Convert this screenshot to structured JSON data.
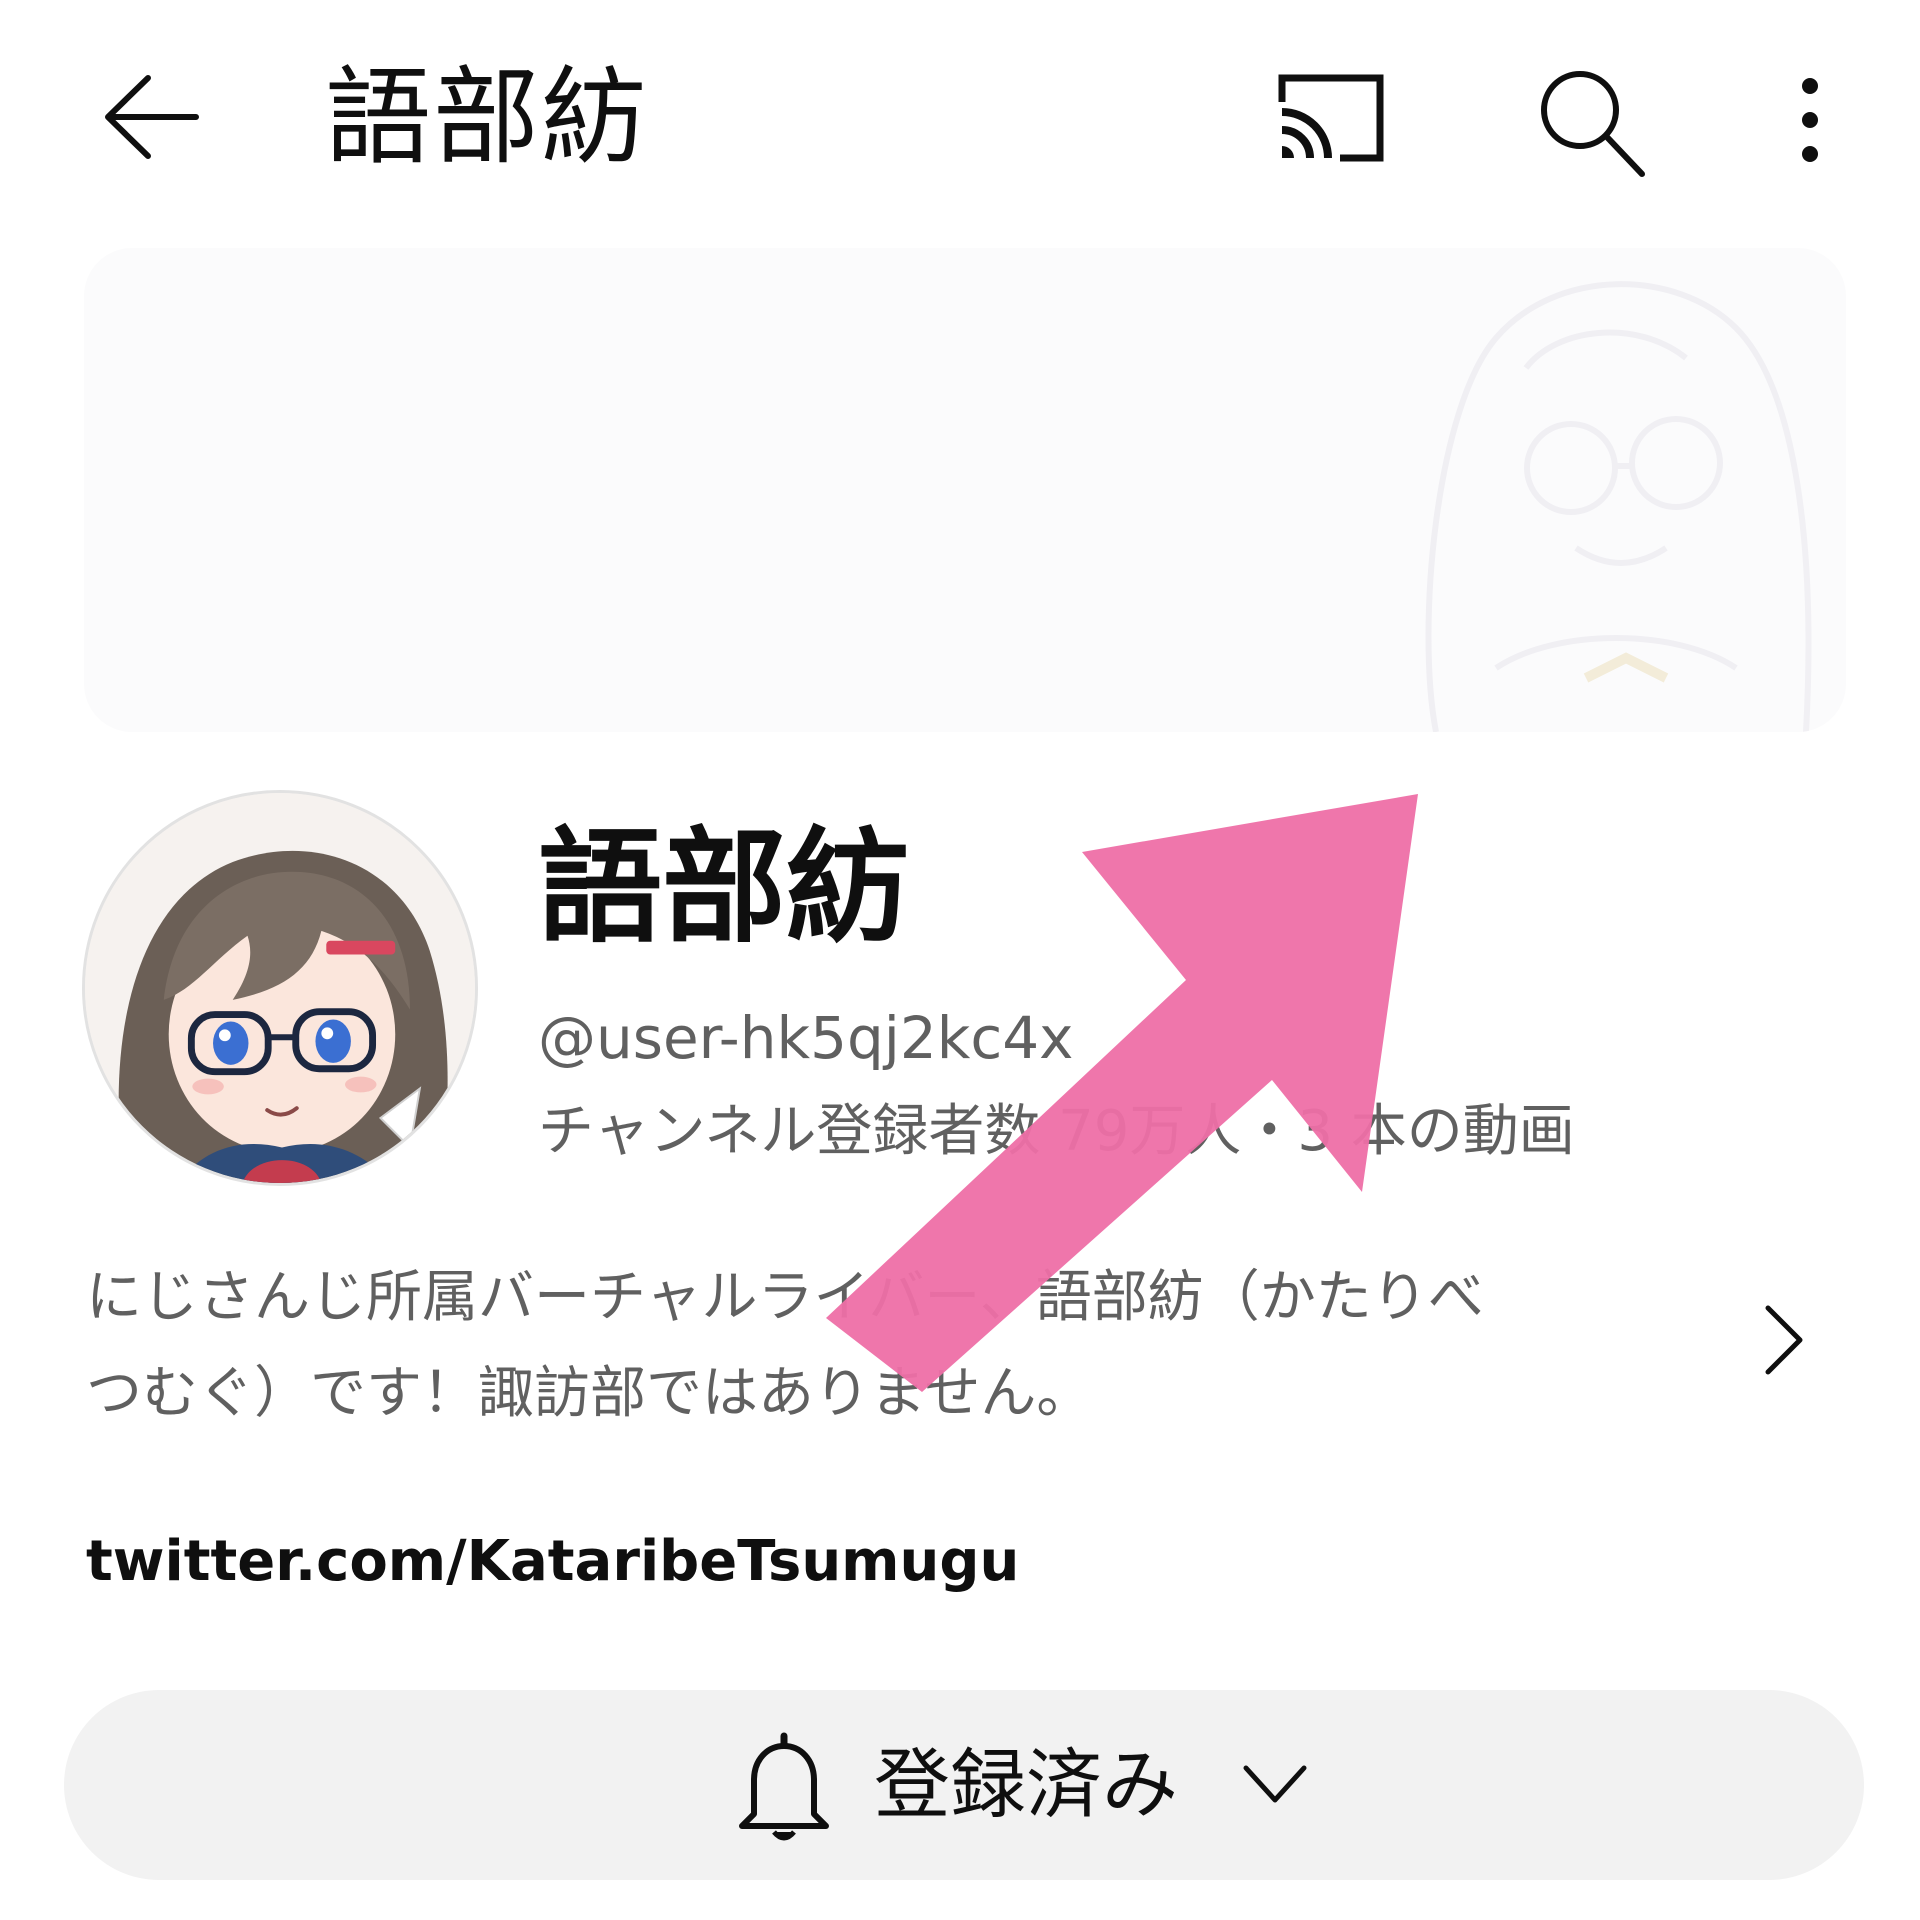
{
  "appbar": {
    "title": "語部紡",
    "icons": [
      "back-arrow-icon",
      "cast-icon",
      "search-icon",
      "more-vert-icon"
    ]
  },
  "channel": {
    "name": "語部紡",
    "handle": "@user-hk5qj2kc4x",
    "stats": "チャンネル登録者数 79万人・3 本の動画",
    "description_line1": "にじさんじ所属バーチャルライバー、語部紡（かたりべ",
    "description_line2": "つむぐ）です！諏訪部ではありません。",
    "link": "twitter.com/KataribeTsumugu"
  },
  "subscribe": {
    "label": "登録済み",
    "icon": "bell-icon"
  },
  "colors": {
    "text_primary": "#0f0f0f",
    "text_secondary": "#606060",
    "button_bg": "#f2f2f2",
    "annotation_pink": "#ee6fa6"
  }
}
